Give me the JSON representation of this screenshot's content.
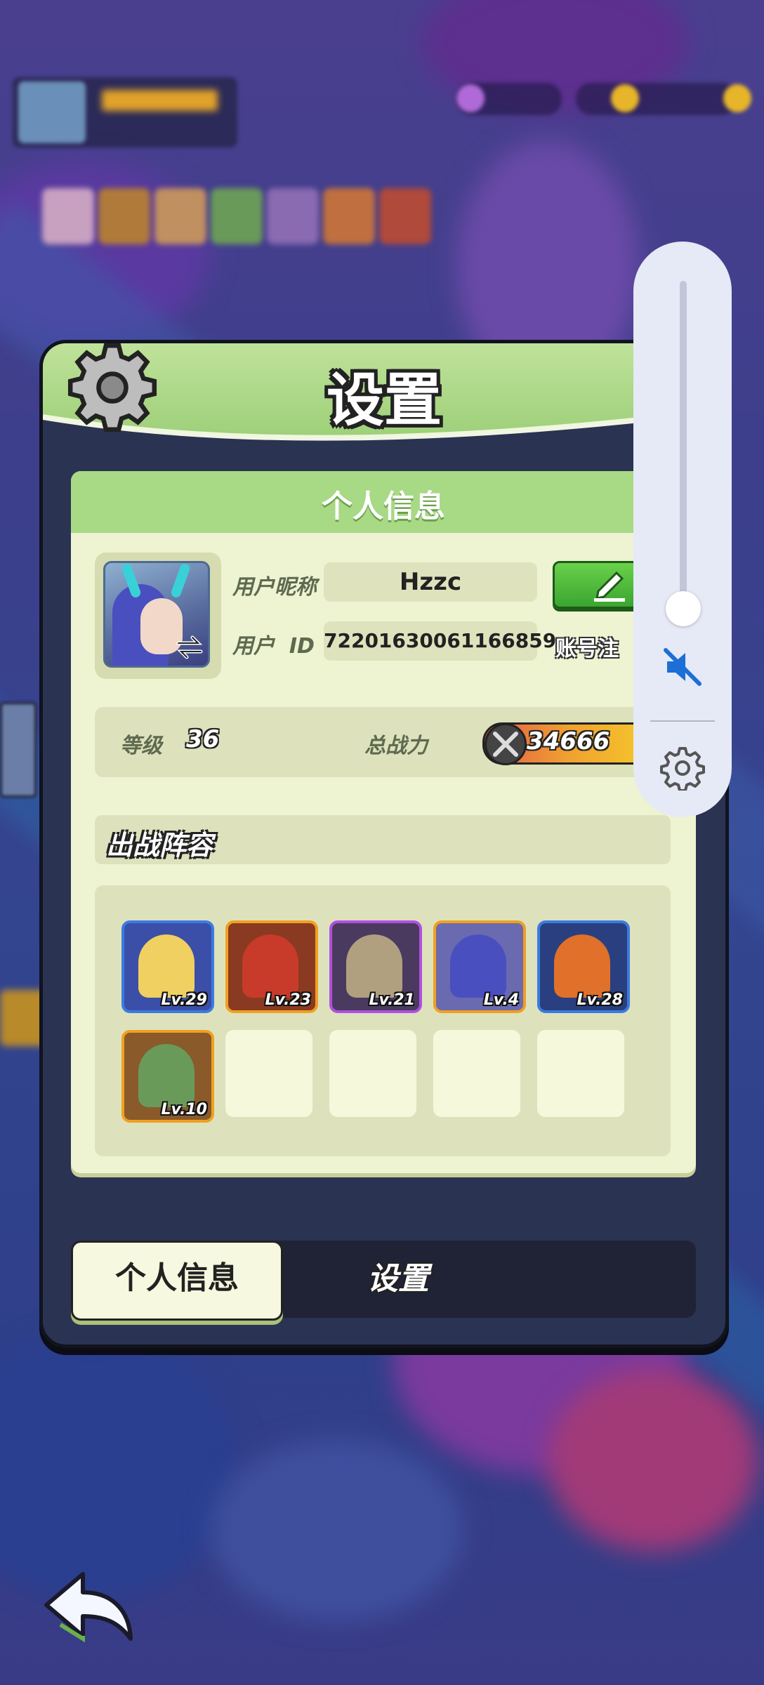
{
  "dialog": {
    "title": "设置",
    "section_title": "个人信息"
  },
  "profile": {
    "nickname_label": "用户昵称",
    "nickname": "Hzzc",
    "id_label": "用户  ID",
    "user_id": "72201630061166859",
    "account_link": "账号注"
  },
  "stats": {
    "level_label": "等级",
    "level": "36",
    "power_label": "总战力",
    "power": "34666"
  },
  "lineup": {
    "title": "出战阵容",
    "heroes": [
      {
        "level": "Lv.29",
        "frame_color": "#3a7be0",
        "bg": "#3b4fa8",
        "figure": "#f0d060"
      },
      {
        "level": "Lv.23",
        "frame_color": "#f0a020",
        "bg": "#8a3a20",
        "figure": "#c83a2a"
      },
      {
        "level": "Lv.21",
        "frame_color": "#b050e0",
        "bg": "#4a3a60",
        "figure": "#b0a080"
      },
      {
        "level": "Lv.4",
        "frame_color": "#f0a020",
        "bg": "#6a6ab0",
        "figure": "#4a4fbf"
      },
      {
        "level": "Lv.28",
        "frame_color": "#3a7be0",
        "bg": "#2a3f80",
        "figure": "#e0702a"
      },
      {
        "level": "Lv.10",
        "frame_color": "#f0a020",
        "bg": "#8a5a2a",
        "figure": "#6a9a5a"
      }
    ],
    "empty_slots": 4
  },
  "tabs": {
    "personal": "个人信息",
    "settings": "设置"
  },
  "colors": {
    "panel": "#2b3353",
    "header_green": "#a8d985",
    "card": "#eef3d2",
    "edit_green": "#3aa530",
    "mute_blue": "#1d6fd6"
  },
  "icons": {
    "header": "gear-icon",
    "avatar_overlay": "swap-icon",
    "edit": "pencil-icon",
    "power": "crossed-swords-icon",
    "back": "back-arrow-icon",
    "volume": "volume-muted-icon",
    "volume_settings": "gear-icon"
  }
}
